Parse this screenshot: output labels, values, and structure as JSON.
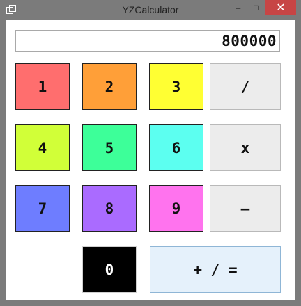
{
  "window": {
    "title": "YZCalculator",
    "min_glyph": "–",
    "max_glyph": "□",
    "close_glyph": "✕"
  },
  "display": {
    "value": "800000"
  },
  "keys": [
    {
      "label": "1",
      "color": "#ff6e6e"
    },
    {
      "label": "2",
      "color": "#ff9f38"
    },
    {
      "label": "3",
      "color": "#ffff33"
    },
    {
      "label": "/",
      "color": "#ececec"
    },
    {
      "label": "4",
      "color": "#d1ff38"
    },
    {
      "label": "5",
      "color": "#3dff99"
    },
    {
      "label": "6",
      "color": "#5cfff0"
    },
    {
      "label": "x",
      "color": "#ececec"
    },
    {
      "label": "7",
      "color": "#6e7dff"
    },
    {
      "label": "8",
      "color": "#aa6bff"
    },
    {
      "label": "9",
      "color": "#ff73ee"
    },
    {
      "label": "–",
      "color": "#ececec"
    },
    {
      "label": "0",
      "color": "#000000",
      "text_color": "#ffffff"
    },
    {
      "label": "+ / =",
      "color": "#e5f1fb"
    }
  ]
}
